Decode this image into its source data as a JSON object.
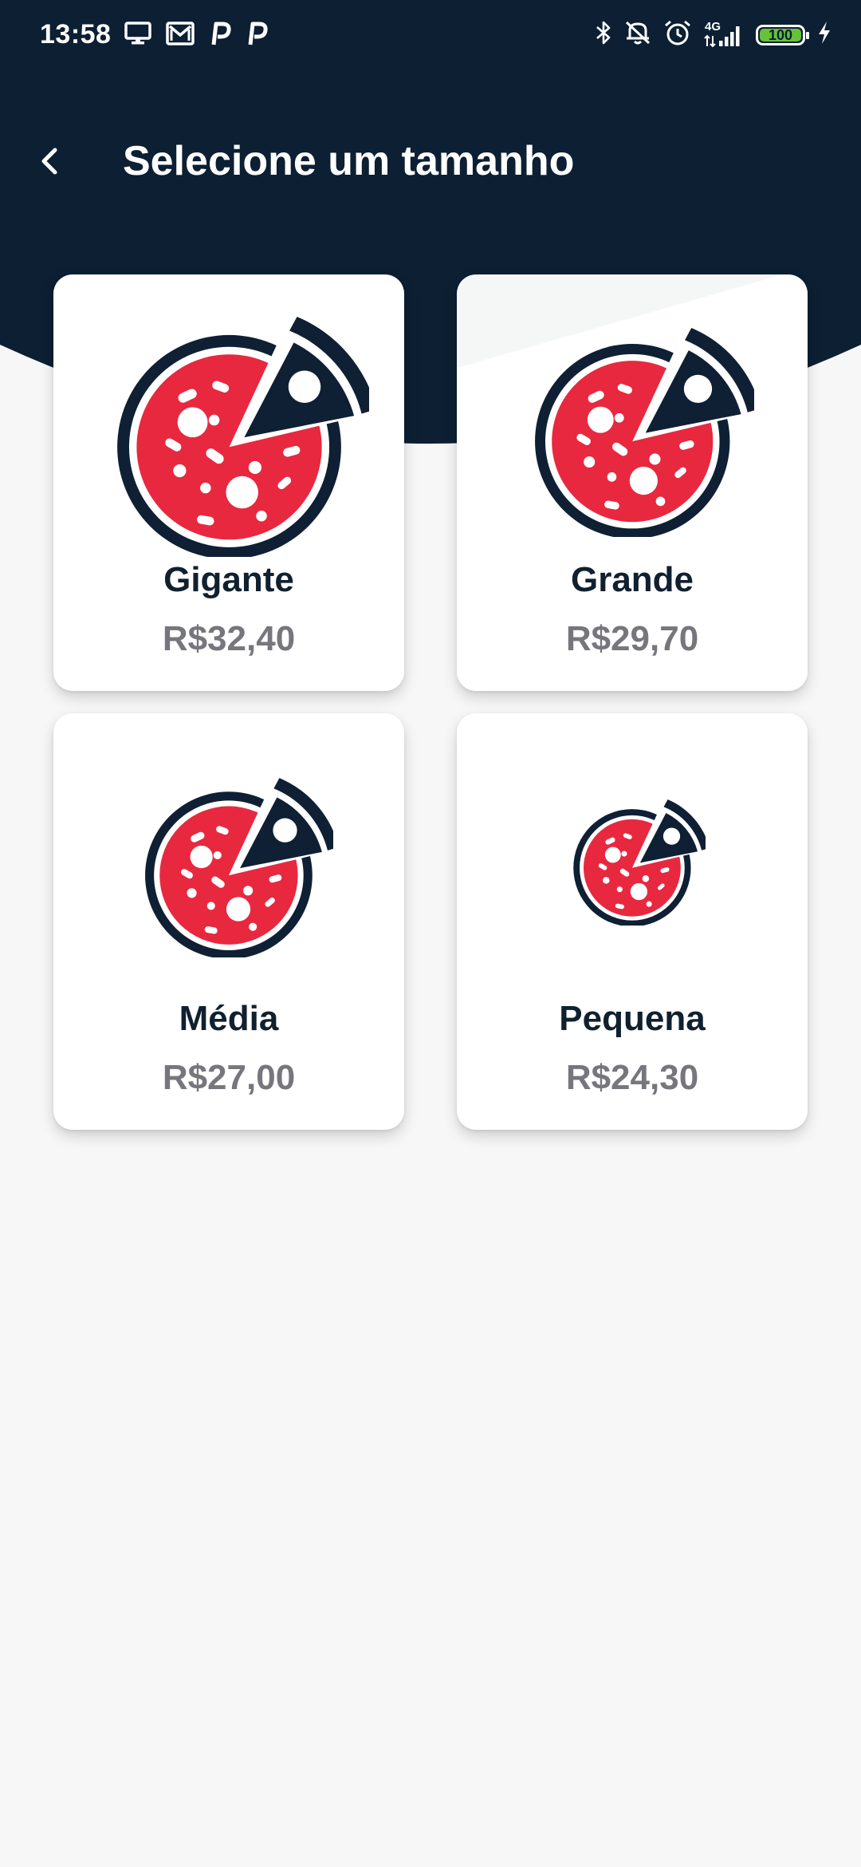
{
  "status_bar": {
    "time": "13:58",
    "battery_level": "100",
    "left_icons": [
      "monitor-icon",
      "gmail-icon",
      "p-app-icon",
      "p-app-icon"
    ],
    "right_icons": [
      "bluetooth-icon",
      "vibrate-off-icon",
      "alarm-icon",
      "signal-4g-icon",
      "battery-icon",
      "charging-icon"
    ],
    "network_label": "4G"
  },
  "header": {
    "title": "Selecione um tamanho",
    "back_icon": "chevron-left-icon"
  },
  "sizes": [
    {
      "name": "Gigante",
      "price": "R$32,40",
      "icon": "pizza-icon"
    },
    {
      "name": "Grande",
      "price": "R$29,70",
      "icon": "pizza-icon"
    },
    {
      "name": "Média",
      "price": "R$27,00",
      "icon": "pizza-icon"
    },
    {
      "name": "Pequena",
      "price": "R$24,30",
      "icon": "pizza-icon"
    }
  ],
  "colors": {
    "header_bg": "#0c1f33",
    "page_bg": "#f7f7f7",
    "pizza_red": "#e8283f",
    "pizza_dark": "#0f2034",
    "price_gray": "#77767d",
    "battery_green": "#67c23a"
  }
}
